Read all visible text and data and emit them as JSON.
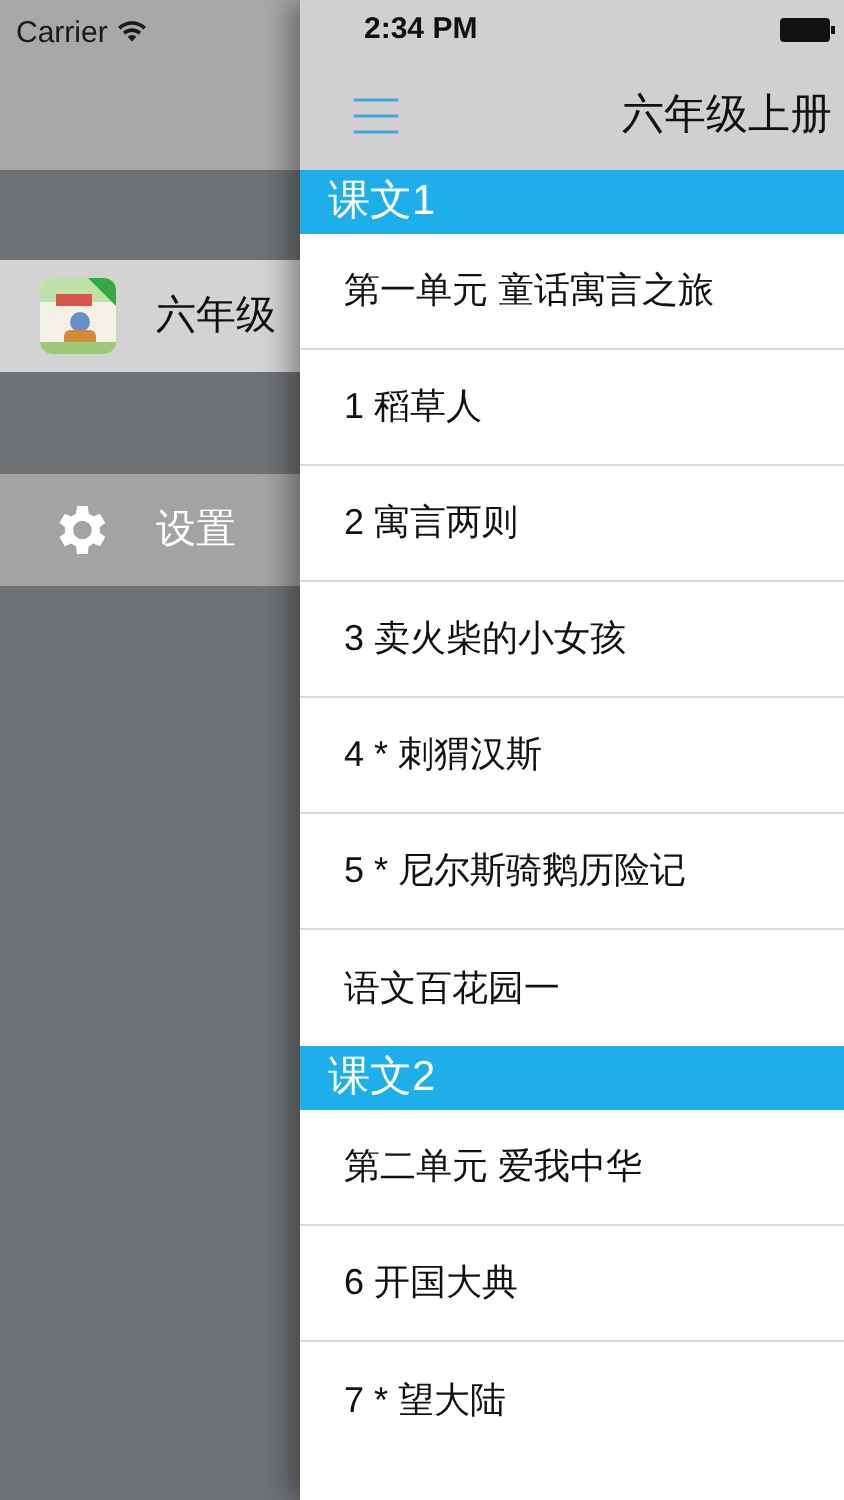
{
  "status_bar": {
    "carrier": "Carrier",
    "time": "2:34 PM"
  },
  "side_menu": {
    "items": [
      {
        "kind": "book",
        "label": "六年级"
      },
      {
        "kind": "settings",
        "label": "设置"
      }
    ]
  },
  "nav_bar": {
    "title": "六年级上册"
  },
  "sections": [
    {
      "header": "课文1",
      "rows": [
        "第一单元 童话寓言之旅",
        "1 稻草人",
        "2 寓言两则",
        "3 卖火柴的小女孩",
        "4 * 刺猬汉斯",
        "5 * 尼尔斯骑鹅历险记",
        "语文百花园一"
      ]
    },
    {
      "header": "课文2",
      "rows": [
        "第二单元 爱我中华",
        "6 开国大典",
        "7 * 望大陆"
      ]
    }
  ]
}
